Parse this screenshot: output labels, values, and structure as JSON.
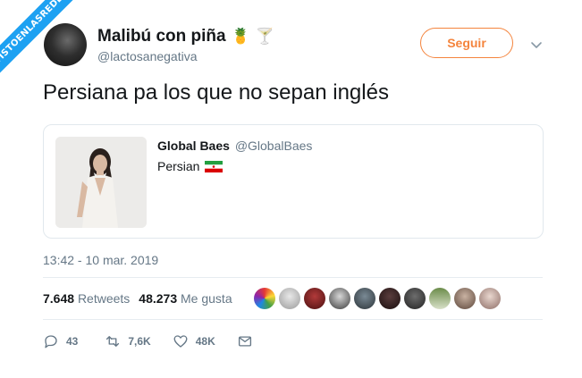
{
  "watermark": "VISTOENLASREDES",
  "header": {
    "display_name": "Malibú con piña",
    "emoji_1": "🍍",
    "emoji_2": "🍸",
    "handle": "@lactosanegativa",
    "follow_label": "Seguir"
  },
  "tweet": {
    "text": "Persiana pa los que no sepan inglés",
    "timestamp": "13:42 - 10 mar. 2019"
  },
  "quote": {
    "name": "Global Baes",
    "handle": "@GlobalBaes",
    "text": "Persian"
  },
  "stats": {
    "retweets_count": "7.648",
    "retweets_label": "Retweets",
    "likes_count": "48.273",
    "likes_label": "Me gusta"
  },
  "actions": {
    "replies": "43",
    "retweets": "7,6K",
    "likes": "48K"
  },
  "colors": {
    "accent": "#f4843d",
    "muted": "#657786",
    "watermark_bg": "#1da1f2"
  }
}
